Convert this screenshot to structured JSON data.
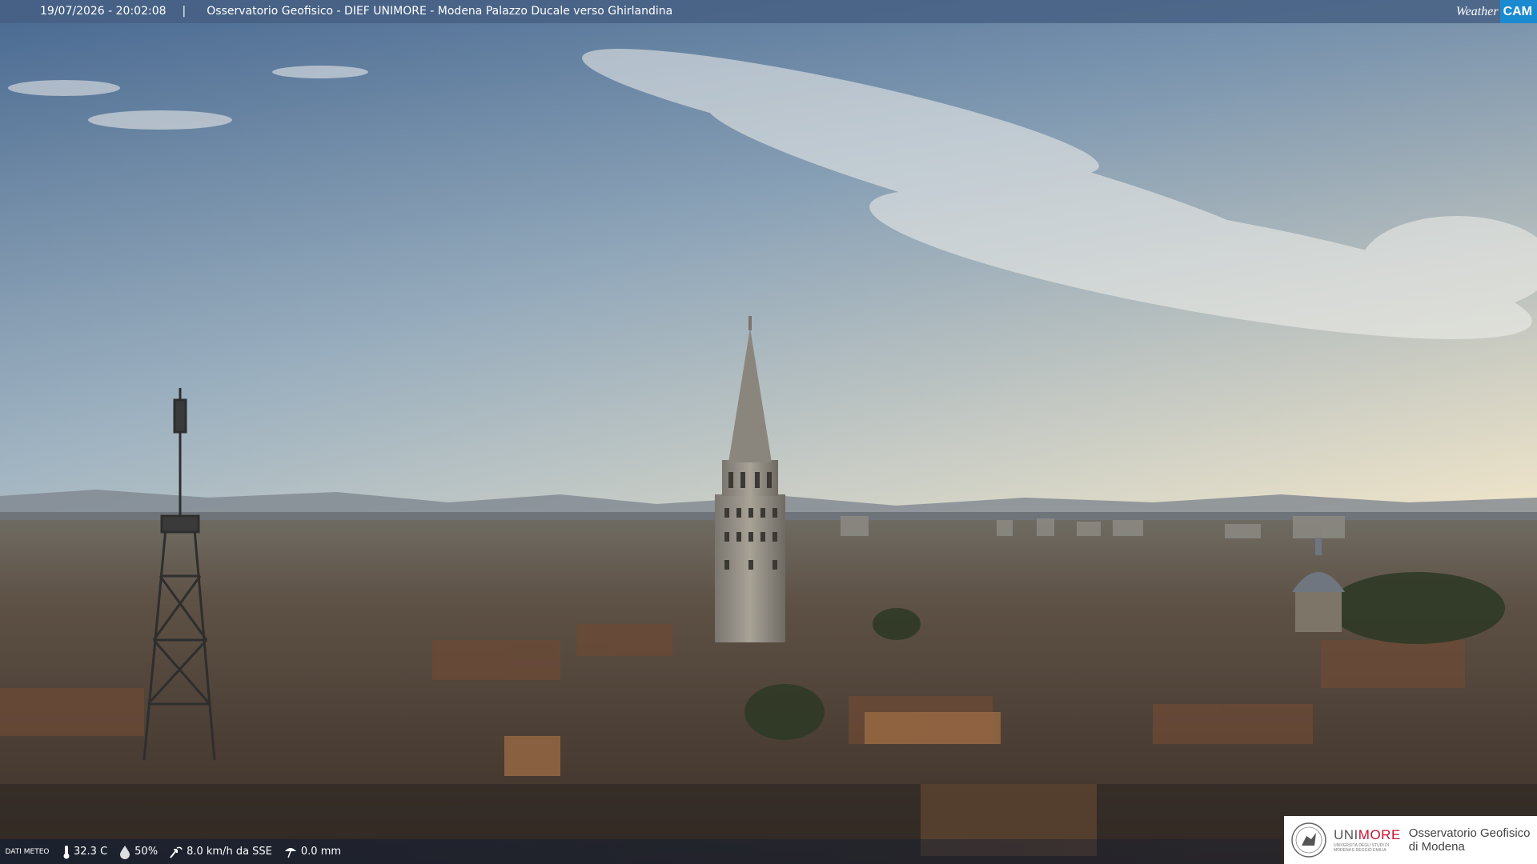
{
  "header": {
    "timestamp": "19/07/2026 - 20:02:08",
    "separator": "|",
    "title": "Osservatorio Geofisico - DIEF UNIMORE - Modena Palazzo Ducale verso Ghirlandina",
    "brand_left": "Weather",
    "brand_right": "CAM"
  },
  "weather": {
    "label": "DATI METEO",
    "temperature": "32.3 C",
    "humidity": "50%",
    "wind": "8.0 km/h da SSE",
    "rain": "0.0 mm"
  },
  "footer_logo": {
    "uni_prefix": "UNI",
    "uni_suffix": "MORE",
    "uni_caption": "UNIVERSITÀ DEGLI STUDI DI MODENA E REGGIO EMILIA",
    "observatory_line1": "Osservatorio Geofisico",
    "observatory_line2": "di Modena"
  },
  "colors": {
    "sky_top": "#5f82aa",
    "sky_horizon": "#e8e2cf",
    "roofs": "#5a463a",
    "brand_blue": "#1a8bd0",
    "unimore_red": "#c8102e"
  },
  "icons": [
    "thermometer-icon",
    "humidity-drop-icon",
    "wind-icon",
    "rain-gauge-icon"
  ]
}
